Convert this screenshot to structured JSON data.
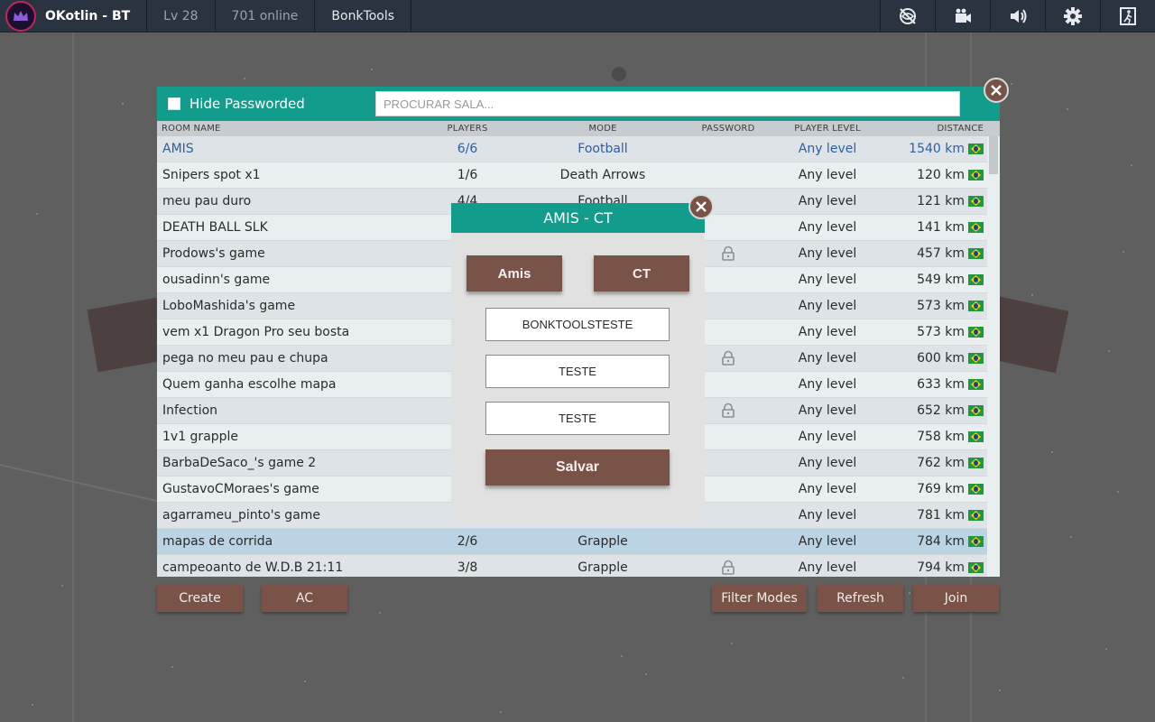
{
  "topbar": {
    "username": "OKotlin - BT",
    "level": "Lv 28",
    "online": "701 online",
    "mod_name": "BonkTools",
    "icons": [
      "privacy-eye-off-icon",
      "camera-icon",
      "volume-icon",
      "gear-icon",
      "exit-icon"
    ]
  },
  "room_list": {
    "hide_passworded_label": "Hide Passworded",
    "hide_passworded_checked": false,
    "search_placeholder": "PROCURAR SALA...",
    "columns": {
      "name": "ROOM NAME",
      "players": "PLAYERS",
      "mode": "MODE",
      "password": "PASSWORD",
      "level": "PLAYER LEVEL",
      "distance": "DISTANCE"
    },
    "rows": [
      {
        "name": "AMIS",
        "players": "6/6",
        "mode": "Football",
        "password": false,
        "level": "Any level",
        "distance": "1540 km"
      },
      {
        "name": "Snipers spot x1",
        "players": "1/6",
        "mode": "Death Arrows",
        "password": false,
        "level": "Any level",
        "distance": "120 km"
      },
      {
        "name": "meu pau duro",
        "players": "4/4",
        "mode": "Football",
        "password": false,
        "level": "Any level",
        "distance": "121 km"
      },
      {
        "name": "DEATH BALL SLK",
        "players": "",
        "mode": "",
        "password": false,
        "level": "Any level",
        "distance": "141 km"
      },
      {
        "name": "Prodows's game",
        "players": "",
        "mode": "",
        "password": true,
        "level": "Any level",
        "distance": "457 km"
      },
      {
        "name": "ousadinn's game",
        "players": "",
        "mode": "",
        "password": false,
        "level": "Any level",
        "distance": "549 km"
      },
      {
        "name": "LoboMashida's game",
        "players": "",
        "mode": "",
        "password": false,
        "level": "Any level",
        "distance": "573 km"
      },
      {
        "name": "vem x1 Dragon Pro seu bosta",
        "players": "",
        "mode": "",
        "password": false,
        "level": "Any level",
        "distance": "573 km"
      },
      {
        "name": "pega no meu pau e chupa",
        "players": "",
        "mode": "",
        "password": true,
        "level": "Any level",
        "distance": "600 km"
      },
      {
        "name": "Quem ganha escolhe mapa",
        "players": "",
        "mode": "",
        "password": false,
        "level": "Any level",
        "distance": "633 km"
      },
      {
        "name": "Infection",
        "players": "",
        "mode": "",
        "password": true,
        "level": "Any level",
        "distance": "652 km"
      },
      {
        "name": "1v1 grapple",
        "players": "",
        "mode": "",
        "password": false,
        "level": "Any level",
        "distance": "758 km"
      },
      {
        "name": "BarbaDeSaco_'s game 2",
        "players": "",
        "mode": "",
        "password": false,
        "level": "Any level",
        "distance": "762 km"
      },
      {
        "name": "GustavoCMoraes's game",
        "players": "",
        "mode": "",
        "password": false,
        "level": "Any level",
        "distance": "769 km"
      },
      {
        "name": "agarrameu_pinto's game",
        "players": "",
        "mode": "",
        "password": false,
        "level": "Any level",
        "distance": "781 km"
      },
      {
        "name": "mapas de corrida",
        "players": "2/6",
        "mode": "Grapple",
        "password": false,
        "level": "Any level",
        "distance": "784 km"
      },
      {
        "name": "campeoanto de W.D.B 21:11",
        "players": "3/8",
        "mode": "Grapple",
        "password": true,
        "level": "Any level",
        "distance": "794 km"
      }
    ]
  },
  "bottom_buttons": {
    "create": "Create",
    "ac": "AC",
    "filter_modes": "Filter Modes",
    "refresh": "Refresh",
    "join": "Join"
  },
  "modal": {
    "title": "AMIS - CT",
    "button_left": "Amis",
    "button_right": "CT",
    "field1": "BONKTOOLSTESTE",
    "field2": "TESTE",
    "field3": "TESTE",
    "save": "Salvar"
  },
  "colors": {
    "teal": "#129c8c",
    "brown": "#7a5348",
    "topbar": "#2a3440",
    "link_blue": "#2c5ea8"
  }
}
